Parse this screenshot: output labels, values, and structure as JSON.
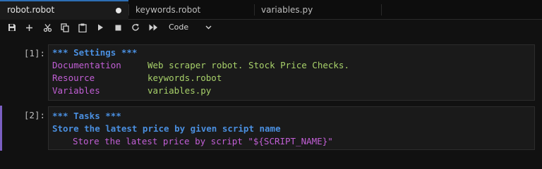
{
  "tabs": [
    {
      "label": "robot.robot",
      "active": true,
      "unsaved": true
    },
    {
      "label": "keywords.robot",
      "active": false
    },
    {
      "label": "variables.py",
      "active": false
    }
  ],
  "toolbar": {
    "icons": [
      "save-icon",
      "add-cell-icon",
      "cut-icon",
      "copy-icon",
      "paste-icon",
      "run-icon",
      "stop-icon",
      "restart-icon",
      "run-all-icon"
    ],
    "cell_type": "Code"
  },
  "cells": [
    {
      "prompt": "[1]:",
      "header": "*** Settings ***",
      "settings": [
        {
          "key": "Documentation",
          "value": "Web scraper robot. Stock Price Checks."
        },
        {
          "key": "Resource",
          "value": "keywords.robot"
        },
        {
          "key": "Variables",
          "value": "variables.py"
        }
      ]
    },
    {
      "prompt": "[2]:",
      "header": "*** Tasks ***",
      "task_name": "Store the latest price by given script name",
      "keyword_call": "Store the latest price by script \"",
      "variable": "${SCRIPT_NAME}",
      "closing_quote": "\""
    }
  ],
  "colors": {
    "accent": "#2d6fb5",
    "active_cell_border": "#7b5fc2",
    "header": "#4a8fe0",
    "setting_key": "#c25fd6",
    "setting_value": "#a8d16a"
  }
}
